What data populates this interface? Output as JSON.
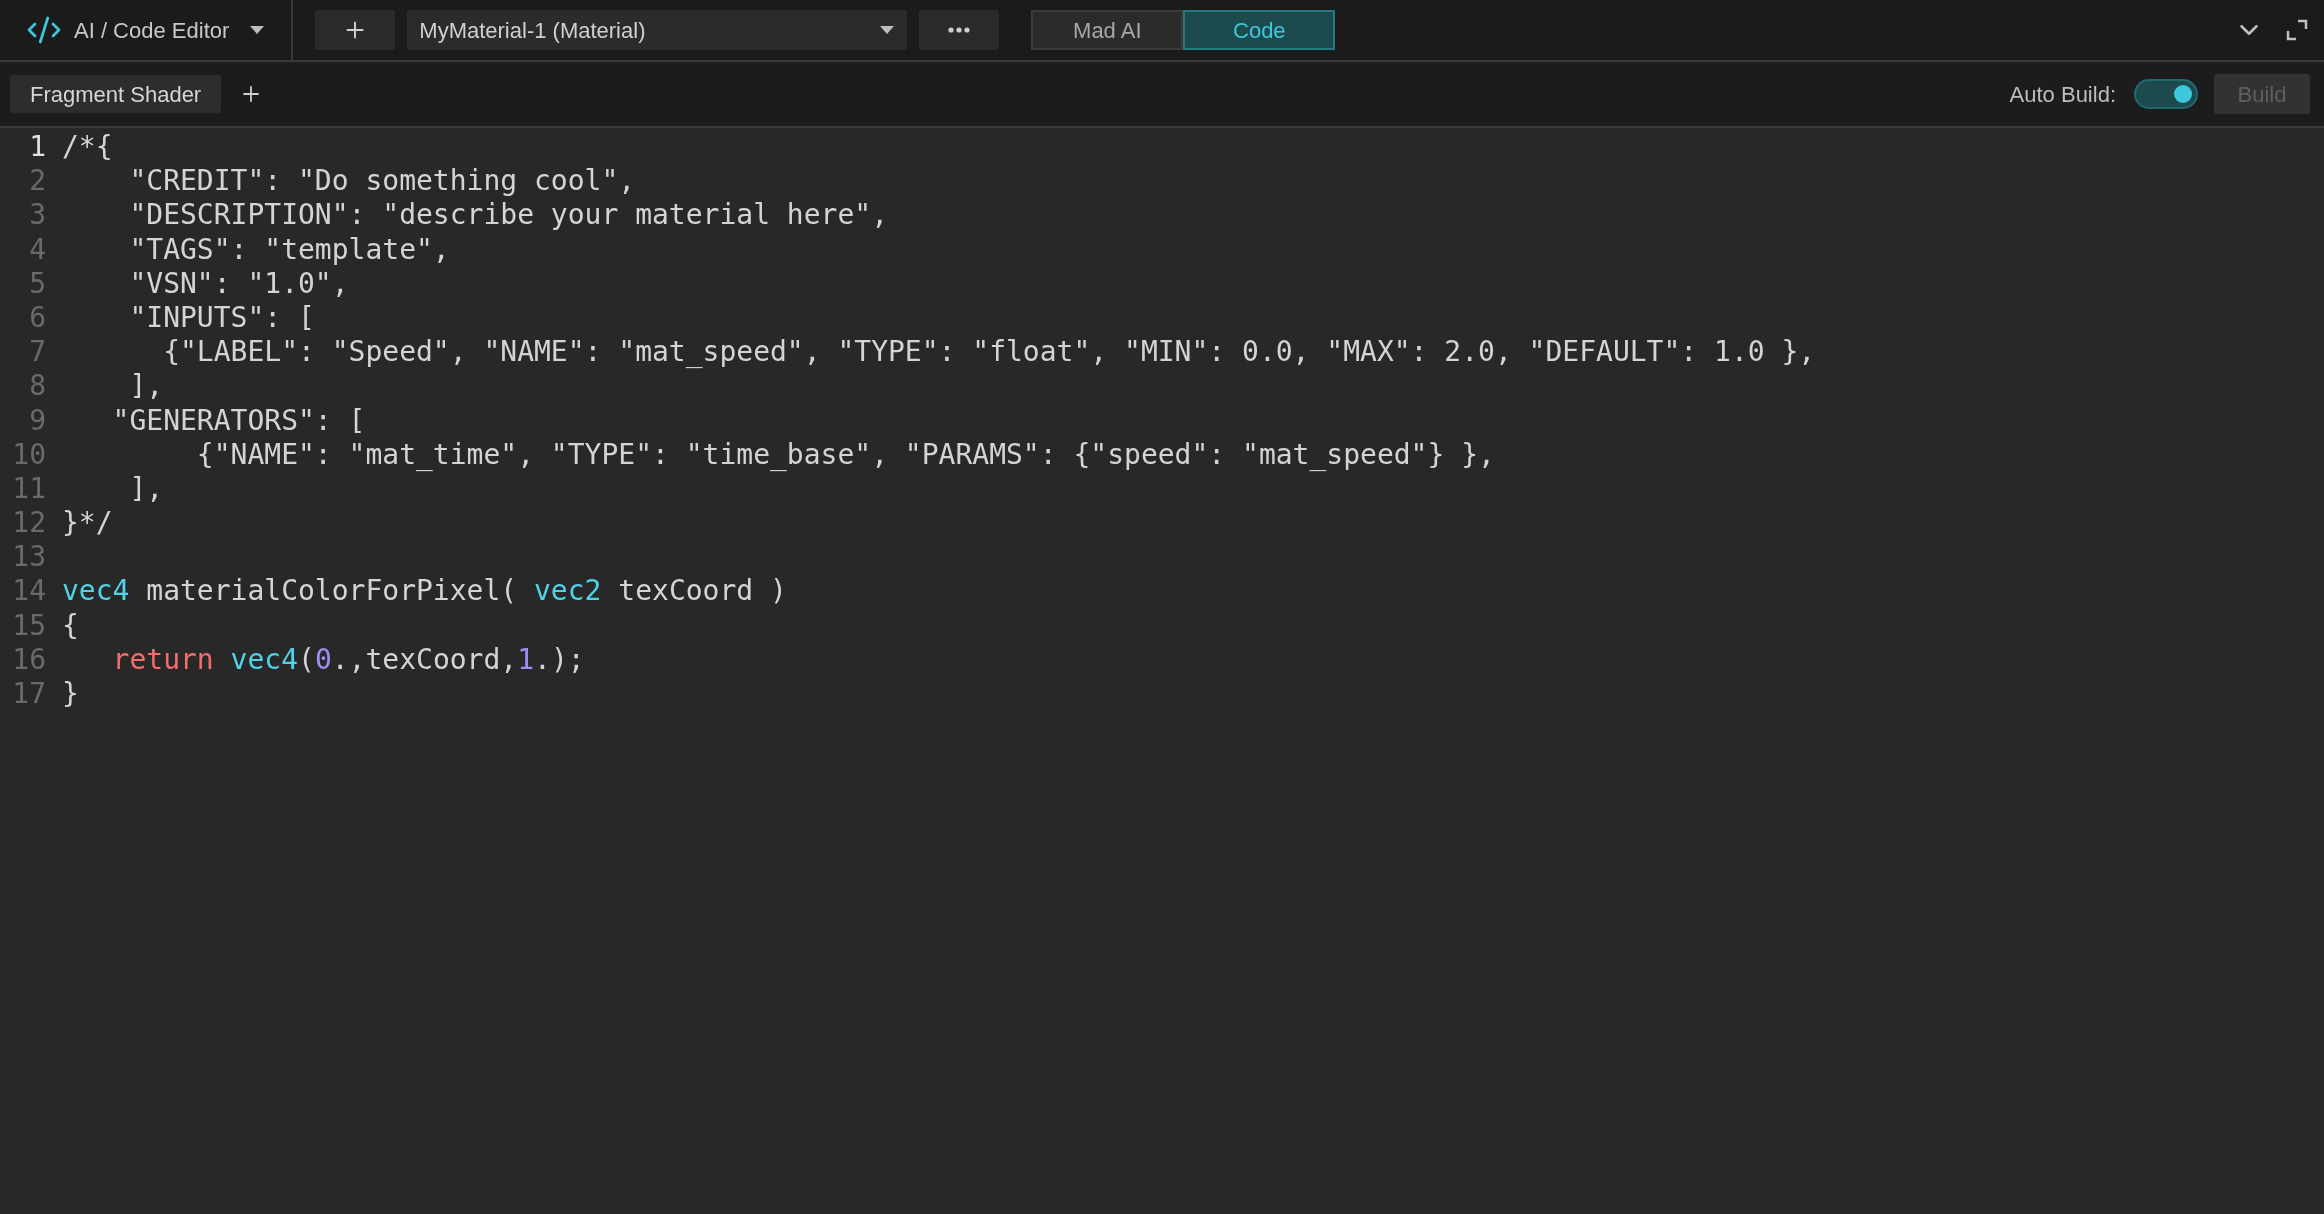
{
  "header": {
    "title": "AI / Code Editor",
    "material": "MyMaterial-1 (Material)",
    "modes": [
      {
        "label": "Mad AI",
        "selected": false
      },
      {
        "label": "Code",
        "selected": true
      }
    ]
  },
  "tabs": [
    {
      "label": "Fragment Shader",
      "selected": true
    }
  ],
  "auto_build": {
    "label": "Auto Build:",
    "on": true
  },
  "build_button": {
    "label": "Build",
    "disabled": true
  },
  "editor": {
    "lines": [
      {
        "number": "1",
        "current": true,
        "tokens": [
          {
            "text": "/*{",
            "kind": "plain"
          }
        ]
      },
      {
        "number": "2",
        "current": false,
        "tokens": [
          {
            "text": "    \"CREDIT\": \"Do something cool\",",
            "kind": "plain"
          }
        ]
      },
      {
        "number": "3",
        "current": false,
        "tokens": [
          {
            "text": "    \"DESCRIPTION\": \"describe your material here\",",
            "kind": "plain"
          }
        ]
      },
      {
        "number": "4",
        "current": false,
        "tokens": [
          {
            "text": "    \"TAGS\": \"template\",",
            "kind": "plain"
          }
        ]
      },
      {
        "number": "5",
        "current": false,
        "tokens": [
          {
            "text": "    \"VSN\": \"1.0\",",
            "kind": "plain"
          }
        ]
      },
      {
        "number": "6",
        "current": false,
        "tokens": [
          {
            "text": "    \"INPUTS\": [",
            "kind": "plain"
          }
        ]
      },
      {
        "number": "7",
        "current": false,
        "tokens": [
          {
            "text": "      {\"LABEL\": \"Speed\", \"NAME\": \"mat_speed\", \"TYPE\": \"float\", \"MIN\": 0.0, \"MAX\": 2.0, \"DEFAULT\": 1.0 },",
            "kind": "plain"
          }
        ]
      },
      {
        "number": "8",
        "current": false,
        "tokens": [
          {
            "text": "    ],",
            "kind": "plain"
          }
        ]
      },
      {
        "number": "9",
        "current": false,
        "tokens": [
          {
            "text": "   \"GENERATORS\": [",
            "kind": "plain"
          }
        ]
      },
      {
        "number": "10",
        "current": false,
        "tokens": [
          {
            "text": "        {\"NAME\": \"mat_time\", \"TYPE\": \"time_base\", \"PARAMS\": {\"speed\": \"mat_speed\"} },",
            "kind": "plain"
          }
        ]
      },
      {
        "number": "11",
        "current": false,
        "tokens": [
          {
            "text": "    ],",
            "kind": "plain"
          }
        ]
      },
      {
        "number": "12",
        "current": false,
        "tokens": [
          {
            "text": "}*/",
            "kind": "plain"
          }
        ]
      },
      {
        "number": "13",
        "current": false
      },
      {
        "number": "14",
        "current": false,
        "tokens": [
          {
            "text": "vec4",
            "kind": "type"
          },
          {
            "text": " materialColorForPixel( ",
            "kind": "plain"
          },
          {
            "text": "vec2",
            "kind": "type"
          },
          {
            "text": " texCoord )",
            "kind": "plain"
          }
        ]
      },
      {
        "number": "15",
        "current": false,
        "tokens": [
          {
            "text": "{",
            "kind": "plain"
          }
        ]
      },
      {
        "number": "16",
        "current": false,
        "tokens": [
          {
            "text": "   return ",
            "kind": "keyword"
          },
          {
            "text": "vec4",
            "kind": "type"
          },
          {
            "text": "(",
            "kind": "plain"
          },
          {
            "text": "0",
            "kind": "number"
          },
          {
            "text": ".,texCoord,",
            "kind": "plain"
          },
          {
            "text": "1",
            "kind": "number"
          },
          {
            "text": ".);",
            "kind": "plain"
          }
        ]
      },
      {
        "number": "17",
        "current": false,
        "tokens": [
          {
            "text": "}",
            "kind": "plain"
          }
        ]
      }
    ]
  }
}
